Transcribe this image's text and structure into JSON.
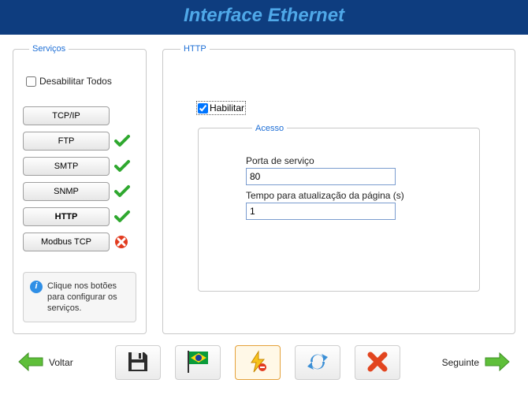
{
  "header": {
    "title": "Interface Ethernet"
  },
  "servicos": {
    "legend": "Serviços",
    "disable_all_label": "Desabilitar Todos",
    "disable_all_checked": false,
    "items": [
      {
        "label": "TCP/IP",
        "status": "none"
      },
      {
        "label": "FTP",
        "status": "ok"
      },
      {
        "label": "SMTP",
        "status": "ok"
      },
      {
        "label": "SNMP",
        "status": "ok"
      },
      {
        "label": "HTTP",
        "status": "ok",
        "active": true
      },
      {
        "label": "Modbus TCP",
        "status": "error"
      }
    ],
    "info_text": "Clique nos botões para configurar os serviços."
  },
  "http": {
    "legend": "HTTP",
    "enable_label": "Habilitar",
    "enable_checked": true,
    "acesso": {
      "legend": "Acesso",
      "port_label": "Porta de serviço",
      "port_value": "80",
      "refresh_label": "Tempo para atualização da página (s)",
      "refresh_value": "1"
    }
  },
  "footer": {
    "back_label": "Voltar",
    "next_label": "Seguinte"
  }
}
